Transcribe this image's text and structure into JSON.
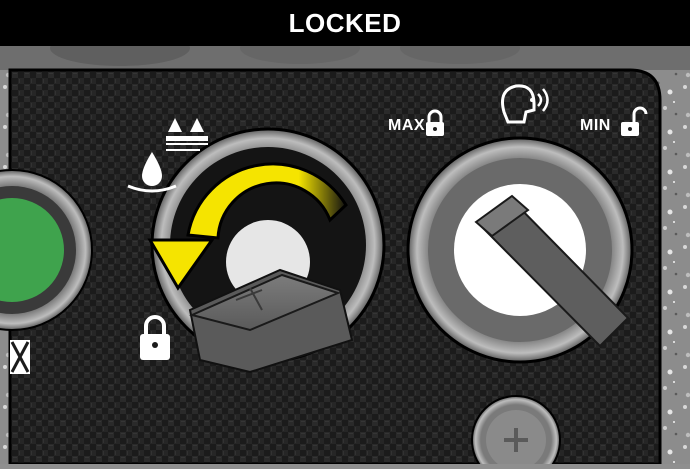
{
  "banner": {
    "title": "LOCKED"
  },
  "left_knob": {
    "state_icon": "lock-closed-icon",
    "function_icons": [
      "water-drop-icon",
      "scrub-brush-icon"
    ],
    "turn_direction": "counter-clockwise"
  },
  "right_knob": {
    "max_label": "MAX",
    "min_label": "MIN",
    "max_icon": "lock-closed-icon",
    "min_icon": "lock-open-icon",
    "function_icon": "voice-head-icon"
  },
  "colors": {
    "banner_bg": "#000000",
    "arrow_yellow": "#f5e400",
    "panel_dark": "#1c1c1c",
    "status_green": "#3fa34d",
    "knob_grey": "#6b6b6b"
  }
}
